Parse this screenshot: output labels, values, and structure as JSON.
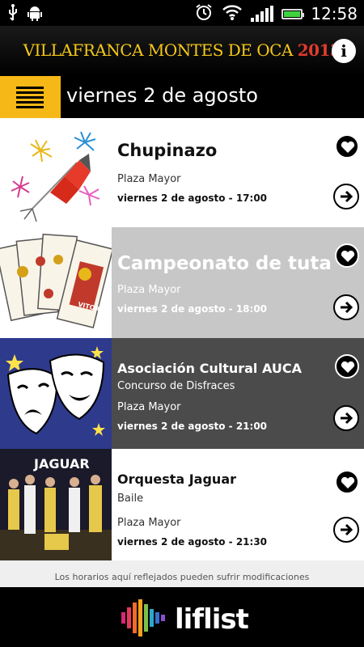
{
  "status_bar": {
    "time": "12:58",
    "icons": [
      "usb-icon",
      "android-debug-icon",
      "alarm-icon",
      "wifi-icon",
      "signal-icon",
      "battery-icon"
    ]
  },
  "header": {
    "title_main": "VILLAFRANCA MONTES DE OCA",
    "title_year": "2013",
    "info_label": "i",
    "title_color": "#f5c817",
    "year_color": "#e03b2c"
  },
  "date_bar": {
    "title": "viernes 2 de agosto",
    "menu_color": "#f5b817"
  },
  "events": [
    {
      "title": "Chupinazo",
      "lines": [
        "Plaza Mayor"
      ],
      "datetime": "viernes 2 de agosto - 17:00",
      "image": "fireworks-rocket-illustration"
    },
    {
      "title": "Campeonato de tuta",
      "lines": [
        "Plaza Mayor"
      ],
      "datetime": "viernes 2 de agosto - 18:00",
      "image": "spanish-playing-cards"
    },
    {
      "title": "Asociación Cultural AUCA",
      "lines": [
        "Concurso de Disfraces",
        "Plaza Mayor"
      ],
      "datetime": "viernes 2 de agosto - 21:00",
      "image": "theater-masks"
    },
    {
      "title": "Orquesta Jaguar",
      "lines": [
        "Baile",
        "Plaza Mayor"
      ],
      "datetime": "viernes 2 de agosto - 21:30",
      "image": "band-photo",
      "image_text": "JAGUAR"
    }
  ],
  "disclaimer": "Los horarios aquí reflejados pueden sufrir modificaciones",
  "footer": {
    "brand": "liflist"
  }
}
